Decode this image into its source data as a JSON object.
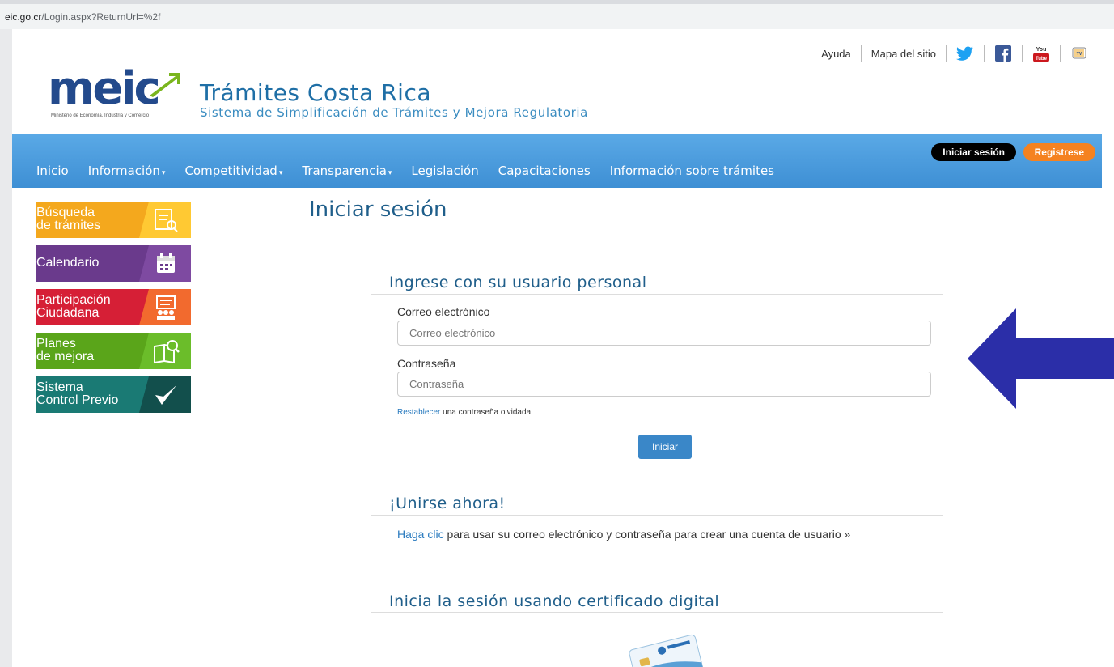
{
  "browser": {
    "url_host": "eic.go.cr",
    "url_path": "/Login.aspx?ReturnUrl=%2f"
  },
  "header": {
    "logo_text": "meic",
    "logo_tagline": "Ministerio de Economía, Industria y Comercio",
    "title": "Trámites Costa Rica",
    "subtitle": "Sistema de Simplificación de Trámites y Mejora Regulatoria",
    "top_links": [
      "Ayuda",
      "Mapa del sitio"
    ],
    "social_icons": [
      "twitter-icon",
      "facebook-icon",
      "youtube-icon",
      "meic-tv-icon"
    ]
  },
  "nav": {
    "items": [
      {
        "label": "Inicio",
        "dropdown": false
      },
      {
        "label": "Información",
        "dropdown": true
      },
      {
        "label": "Competitividad",
        "dropdown": true
      },
      {
        "label": "Transparencia",
        "dropdown": true
      },
      {
        "label": "Legislación",
        "dropdown": false
      },
      {
        "label": "Capacitaciones",
        "dropdown": false
      },
      {
        "label": "Información sobre trámites",
        "dropdown": false
      }
    ],
    "login_label": "Iniciar sesión",
    "register_label": "Registrese"
  },
  "sidebar": {
    "items": [
      {
        "line1": "Búsqueda",
        "line2": "de trámites",
        "color": "#f4a81d",
        "panel": "#ffc933",
        "icon": "search-document-icon"
      },
      {
        "line1": "Calendario",
        "line2": "",
        "color": "#6a3a8c",
        "panel": "#7e4aa1",
        "icon": "calendar-icon"
      },
      {
        "line1": "Participación",
        "line2": "Ciudadana",
        "color": "#d61f36",
        "panel": "#f26a2e",
        "icon": "people-board-icon"
      },
      {
        "line1": "Planes",
        "line2": "de mejora",
        "color": "#5aa51a",
        "panel": "#6bbd2a",
        "icon": "book-magnifier-icon"
      },
      {
        "line1": "Sistema",
        "line2": "Control Previo",
        "color": "#1a7a74",
        "panel": "#124f4c",
        "icon": "checkmark-arrow-icon"
      }
    ]
  },
  "main": {
    "page_title": "Iniciar sesión",
    "section_personal": "Ingrese con su usuario personal",
    "email_label": "Correo electrónico",
    "email_placeholder": "Correo electrónico",
    "password_label": "Contraseña",
    "password_placeholder": "Contraseña",
    "forgot_link": "Restablecer",
    "forgot_text": " una contraseña olvidada.",
    "submit_label": "Iniciar",
    "section_join": "¡Unirse ahora!",
    "join_link": "Haga clic",
    "join_text": " para usar su correo electrónico y contraseña para crear una cuenta de usuario »",
    "section_cert": "Inicia la sesión usando certificado digital"
  },
  "colors": {
    "nav_blue": "#4a9ad9",
    "heading_blue": "#1f5e8a",
    "annotation_arrow": "#2b2ea8",
    "register_orange": "#f58220"
  }
}
